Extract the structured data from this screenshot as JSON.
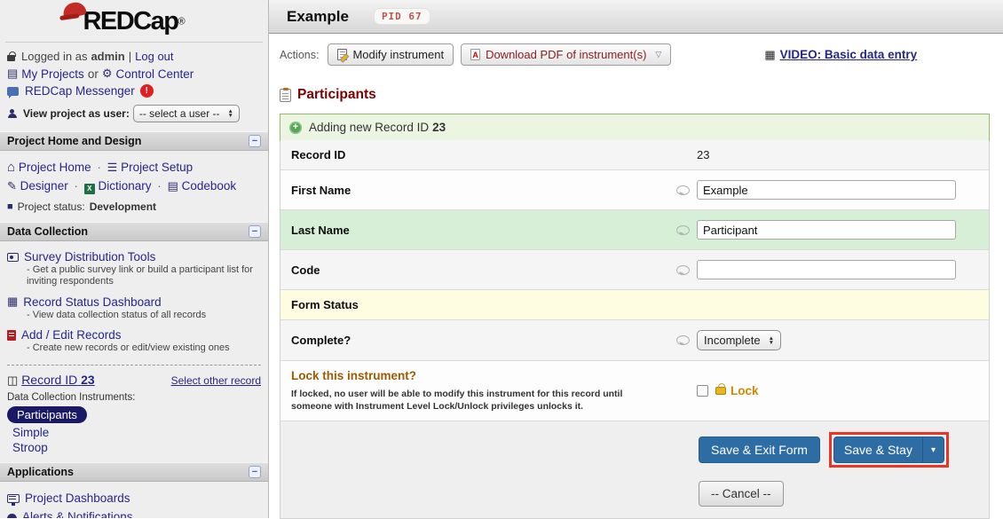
{
  "icons": {
    "list": "▤",
    "gear": "⚙",
    "home": "⌂",
    "menu": "☰",
    "pencil": "✎",
    "grid": "▦",
    "columns": "◫",
    "film": "▦",
    "caret_down": "▾",
    "chevron_down": "▽",
    "square": "■",
    "dot": "·",
    "minus": "−",
    "arrow_up": "▲",
    "arrow_down": "▼",
    "plus": "+",
    "exclaim": "!",
    "x": "X",
    "reg": "®"
  },
  "colors": {
    "button_blue": "#2e6da4",
    "annotation_red": "#ee3424",
    "heading_maroon": "#7d0000",
    "lock_orange": "#d18700",
    "link_navy": "#26268c",
    "add_edit_red": "#a00000",
    "pill_navy": "#191966",
    "banner_green_bg": "#ecf4e2",
    "row_green": "#d7efd7",
    "row_yellow": "#fffde1",
    "cap_red": "#c32b25"
  },
  "sidebar": {
    "logo_text": "REDCap",
    "login": {
      "prefix": "Logged in as",
      "user": "admin",
      "sep": "|",
      "logout": "Log out"
    },
    "nav": {
      "my_projects": "My Projects",
      "or": "or",
      "control_center": "Control Center",
      "messenger": "REDCap Messenger"
    },
    "view_as": {
      "label": "View project as user:",
      "value": "-- select a user --"
    },
    "home_section": {
      "title": "Project Home and Design",
      "project_home": "Project Home",
      "project_setup": "Project Setup",
      "designer": "Designer",
      "dictionary": "Dictionary",
      "codebook": "Codebook",
      "status_label": "Project status:",
      "status_value": "Development"
    },
    "data_section": {
      "title": "Data Collection",
      "survey_tools": "Survey Distribution Tools",
      "survey_desc": "- Get a public survey link or build a participant list for inviting respondents",
      "dashboard": "Record Status Dashboard",
      "dashboard_desc": "- View data collection status of all records",
      "add_edit": "Add / Edit Records",
      "add_edit_desc": "- Create new records or edit/view existing ones",
      "record_label": "Record ID",
      "record_id": "23",
      "select_other": "Select other record",
      "instruments_label": "Data Collection Instruments:",
      "instrument_1": "Participants",
      "instrument_2": "Simple",
      "instrument_3": "Stroop"
    },
    "apps_section": {
      "title": "Applications",
      "dashboards": "Project Dashboards",
      "alerts": "Alerts & Notifications"
    }
  },
  "main": {
    "header": {
      "title": "Example",
      "pid": "PID 67"
    },
    "actions": {
      "label": "Actions:",
      "modify": "Modify instrument",
      "download_pdf": "Download PDF of instrument(s)",
      "video": "VIDEO: Basic data entry"
    },
    "form": {
      "heading": "Participants",
      "banner_text": "Adding new Record ID",
      "banner_value": "23",
      "record_id_label": "Record ID",
      "record_id_value": "23",
      "first_name_label": "First Name",
      "first_name_value": "Example",
      "last_name_label": "Last Name",
      "last_name_value": "Participant",
      "code_label": "Code",
      "code_value": "",
      "form_status_label": "Form Status",
      "complete_label": "Complete?",
      "complete_value": "Incomplete",
      "lock_heading": "Lock this instrument?",
      "lock_desc": "If locked, no user will be able to modify this instrument for this record until someone with Instrument Level Lock/Unlock privileges unlocks it.",
      "lock_label": "Lock",
      "save_exit": "Save & Exit Form",
      "save_stay": "Save & Stay",
      "cancel": "-- Cancel --"
    }
  }
}
